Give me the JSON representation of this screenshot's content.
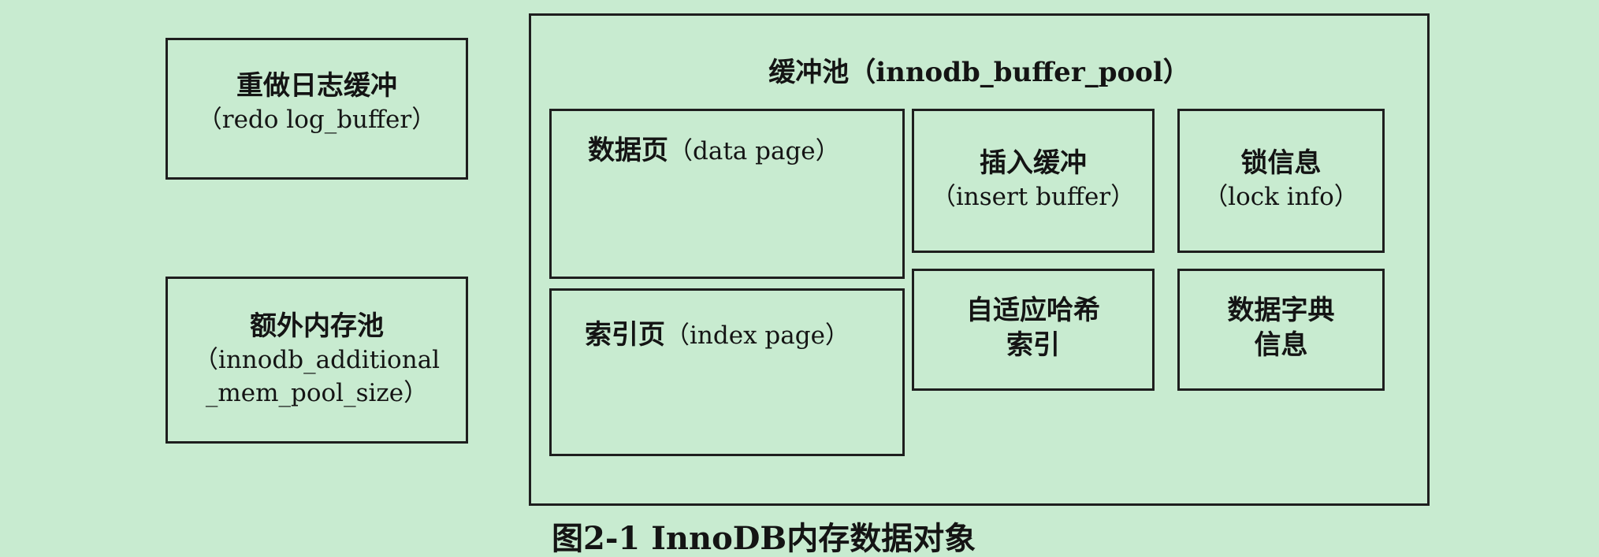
{
  "redo_log_buffer": {
    "title": "重做日志缓冲",
    "subtitle": "（redo log_buffer）"
  },
  "additional_mem_pool": {
    "title": "额外内存池",
    "subtitle_line1": "（innodb_additional",
    "subtitle_line2": "_mem_pool_size）"
  },
  "buffer_pool": {
    "title": "缓冲池（innodb_buffer_pool）",
    "data_page": {
      "title": "数据页",
      "subtitle": "（data page）"
    },
    "index_page": {
      "title": "索引页",
      "subtitle": "（index page）"
    },
    "insert_buffer": {
      "title": "插入缓冲",
      "subtitle": "（insert buffer）"
    },
    "lock_info": {
      "title": "锁信息",
      "subtitle": "（lock info）"
    },
    "adaptive_hash_index": {
      "line1": "自适应哈希",
      "line2": "索引"
    },
    "data_dictionary": {
      "line1": "数据字典",
      "line2": "信息"
    }
  },
  "caption": "图2-1 InnoDB内存数据对象"
}
